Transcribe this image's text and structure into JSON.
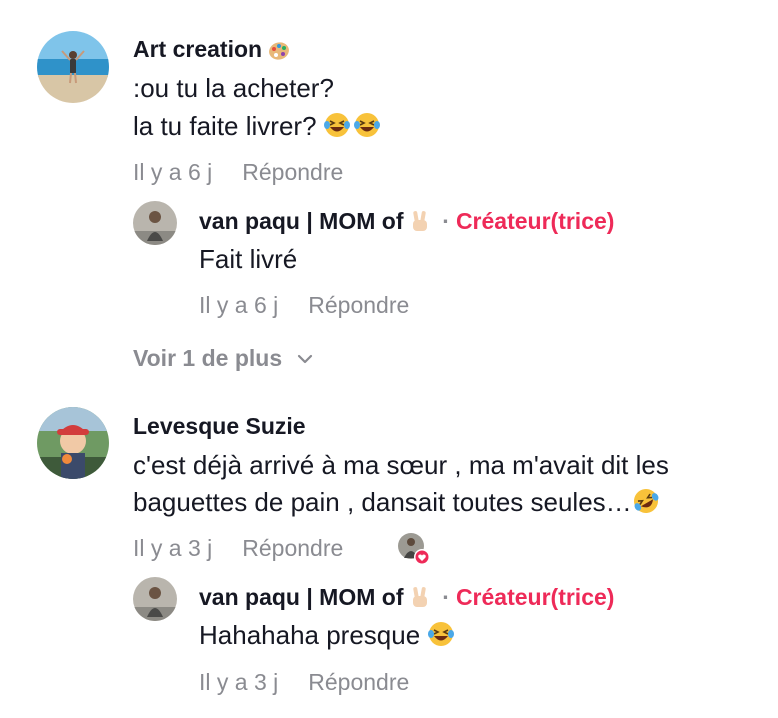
{
  "comments": [
    {
      "author": "Art creation",
      "author_emoji_icon": "palette-icon",
      "lines": [
        ":ou tu la acheter?",
        "la tu faite livrer?"
      ],
      "line_emoji_icon": "laughing-tears-icon",
      "time": "Il y a 6 j",
      "reply_label": "Répondre",
      "reply": {
        "author": "van paqu | MOM of",
        "author_emoji_icon": "victory-hand-icon",
        "separator": "·",
        "badge": "Créateur(trice)",
        "text": "Fait livré",
        "time": "Il y a 6 j",
        "reply_label": "Répondre"
      },
      "more_label": "Voir 1 de plus"
    },
    {
      "author": "Levesque Suzie",
      "lines": [
        "c'est déjà arrivé à ma sœur , ma m'avait dit les",
        "baguettes de pain , dansait toutes seules…"
      ],
      "line_emoji_icon": "rolling-laughing-icon",
      "time": "Il y a 3 j",
      "reply_label": "Répondre",
      "liked_by_creator_icon": "creator-heart-icon",
      "reply": {
        "author": "van paqu | MOM of",
        "author_emoji_icon": "victory-hand-icon",
        "separator": "·",
        "badge": "Créateur(trice)",
        "text": "Hahahaha presque",
        "text_emoji_icon": "laughing-tears-icon",
        "time": "Il y a 3 j",
        "reply_label": "Répondre"
      }
    }
  ],
  "colors": {
    "text": "#161823",
    "muted": "#8a8b91",
    "creator_badge": "#ee2a58",
    "emoji_yellow": "#f8c23a"
  }
}
